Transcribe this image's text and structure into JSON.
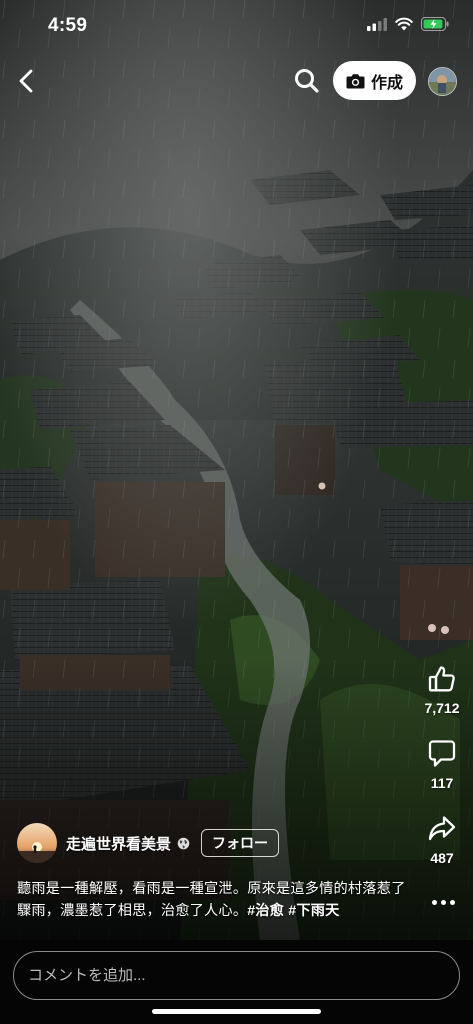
{
  "status_bar": {
    "time": "4:59",
    "battery_color": "#34c759"
  },
  "top_bar": {
    "create_label": "作成"
  },
  "actions": {
    "likes": "7,712",
    "comments": "117",
    "shares": "487"
  },
  "author": {
    "name": "走遍世界看美景",
    "follow_label": "フォロー"
  },
  "caption": {
    "text": "聽雨是一種解壓，看雨是一種宣泄。原來是這多情的村落惹了驟雨，濃墨惹了相思，治愈了人心。",
    "tags": [
      "#治愈",
      "#下雨天"
    ]
  },
  "comment_bar": {
    "placeholder": "コメントを追加..."
  }
}
